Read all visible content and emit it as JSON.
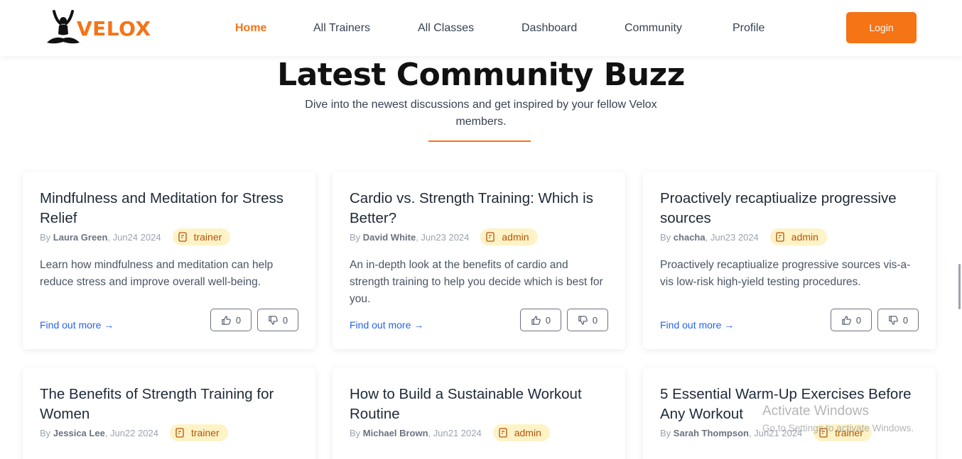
{
  "brand": {
    "name": "VELOX",
    "color": "#f47416"
  },
  "nav": {
    "links": [
      {
        "label": "Home",
        "active": true
      },
      {
        "label": "All Trainers",
        "active": false
      },
      {
        "label": "All Classes",
        "active": false
      },
      {
        "label": "Dashboard",
        "active": false
      },
      {
        "label": "Community",
        "active": false
      },
      {
        "label": "Profile",
        "active": false
      }
    ],
    "login_label": "Login"
  },
  "section": {
    "title": "Latest Community Buzz",
    "subtitle": "Dive into the newest discussions and get inspired by your fellow Velox members."
  },
  "posts": [
    {
      "title": "Mindfulness and Meditation for Stress Relief",
      "by": "By",
      "author": "Laura Green",
      "date": ", Jun24 2024",
      "role": "trainer",
      "excerpt": "Learn how mindfulness and meditation can help reduce stress and improve overall well-being.",
      "link": "Find out more →",
      "upvotes": "0",
      "downvotes": "0"
    },
    {
      "title": "Cardio vs. Strength Training: Which is Better?",
      "by": "By",
      "author": "David White",
      "date": ", Jun23 2024",
      "role": "admin",
      "excerpt": "An in-depth look at the benefits of cardio and strength training to help you decide which is best for you.",
      "link": "Find out more →",
      "upvotes": "0",
      "downvotes": "0"
    },
    {
      "title": "Proactively recaptiualize progressive sources",
      "by": "By",
      "author": "chacha",
      "date": ", Jun23 2024",
      "role": "admin",
      "excerpt": "Proactively recaptiualize progressive sources vis-a-vis low-risk high-yield testing procedures.",
      "link": "Find out more →",
      "upvotes": "0",
      "downvotes": "0"
    },
    {
      "title": "The Benefits of Strength Training for Women",
      "by": "By",
      "author": "Jessica Lee",
      "date": ", Jun22 2024",
      "role": "trainer"
    },
    {
      "title": "How to Build a Sustainable Workout Routine",
      "by": "By",
      "author": "Michael Brown",
      "date": ", Jun21 2024",
      "role": "admin"
    },
    {
      "title": "5 Essential Warm-Up Exercises Before Any Workout",
      "by": "By",
      "author": "Sarah Thompson",
      "date": ", Jun21 2024",
      "role": "trainer"
    }
  ],
  "watermark": {
    "line1": "Activate Windows",
    "line2": "Go to Settings to activate Windows."
  },
  "icons": [
    "doc-icon",
    "thumbs-up-icon",
    "thumbs-down-icon",
    "meditation-logo-icon"
  ]
}
